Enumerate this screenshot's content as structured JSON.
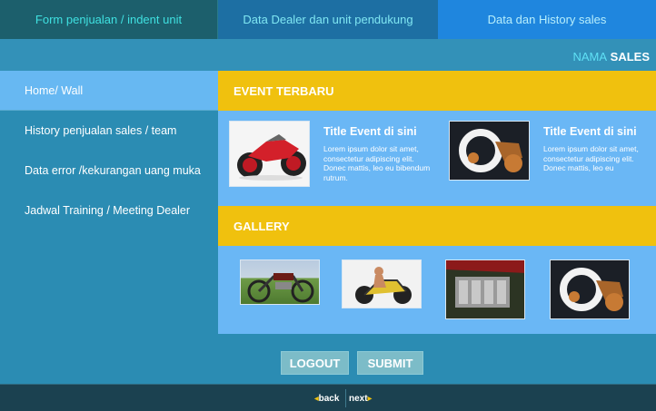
{
  "tabs": [
    {
      "label": "Form penjualan / indent unit"
    },
    {
      "label": "Data Dealer dan unit pendukung"
    },
    {
      "label": "Data dan History sales"
    }
  ],
  "header": {
    "nama": "NAMA",
    "sales": "SALES"
  },
  "sidebar": {
    "items": [
      {
        "label": "Home/ Wall"
      },
      {
        "label": "History penjualan sales / team"
      },
      {
        "label": "Data error /kekurangan uang muka"
      },
      {
        "label": "Jadwal Training / Meeting Dealer"
      }
    ]
  },
  "events": {
    "heading": "EVENT TERBARU",
    "items": [
      {
        "title": "Title Event di sini",
        "desc": "Lorem ipsum dolor sit amet, consectetur adipiscing elit. Donec mattis, leo eu bibendum rutrum.",
        "image": "red-concept-motorcycle"
      },
      {
        "title": "Title Event di sini",
        "desc": "Lorem ipsum dolor sit amet, consectetur adipiscing elit. Donec mattis, leo eu",
        "image": "hubless-concept-motorcycle"
      }
    ]
  },
  "gallery": {
    "heading": "GALLERY",
    "images": [
      "classic-motorcycle",
      "model-with-motorcycle",
      "motorcycle-engine",
      "hubless-concept-motorcycle"
    ]
  },
  "buttons": {
    "logout": "LOGOUT",
    "submit": "SUBMIT"
  },
  "footer": {
    "back": "back",
    "next": "next"
  },
  "colors": {
    "accent": "#f0c10e",
    "main_bg": "#6ab7f5",
    "page_bg": "#2b8cb3"
  }
}
